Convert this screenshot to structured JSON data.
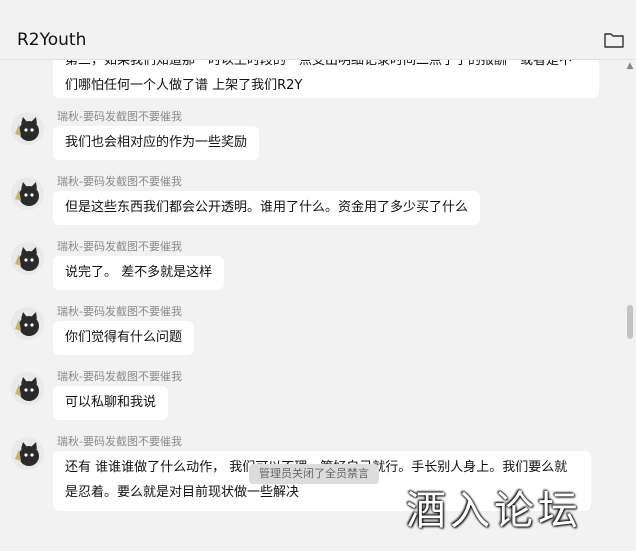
{
  "header": {
    "title": "R2Youth",
    "folder_icon": "folder-icon"
  },
  "partial_message": {
    "line1": "第三，如果我们知道那一时以上时段的一点支出明细记录时间二点了了的报酬一或者是不",
    "line2": "们哪怕任何一个人做了谱 上架了我们R2Y"
  },
  "messages": [
    {
      "sender": "瑞秋-要码发截图不要催我",
      "text": "我们也会相对应的作为一些奖励"
    },
    {
      "sender": "瑞秋-要码发截图不要催我",
      "text": "但是这些东西我们都会公开透明。谁用了什么。资金用了多少买了什么"
    },
    {
      "sender": "瑞秋-要码发截图不要催我",
      "text": "说完了。 差不多就是这样"
    },
    {
      "sender": "瑞秋-要码发截图不要催我",
      "text": "你们觉得有什么问题"
    },
    {
      "sender": "瑞秋-要码发截图不要催我",
      "text": "可以私聊和我说"
    },
    {
      "sender": "瑞秋-要码发截图不要催我",
      "text": "还有 谁谁谁做了什么动作， 我们可以不理。管好自己就行。手长别人身上。我们要么就是忍着。要么就是对目前现状做一些解决"
    }
  ],
  "system_notice": "管理员关闭了全员禁言",
  "watermark": "酒入论坛",
  "colors": {
    "background": "#f2f2f2",
    "bubble": "#ffffff",
    "sender": "#8a8a8a"
  }
}
